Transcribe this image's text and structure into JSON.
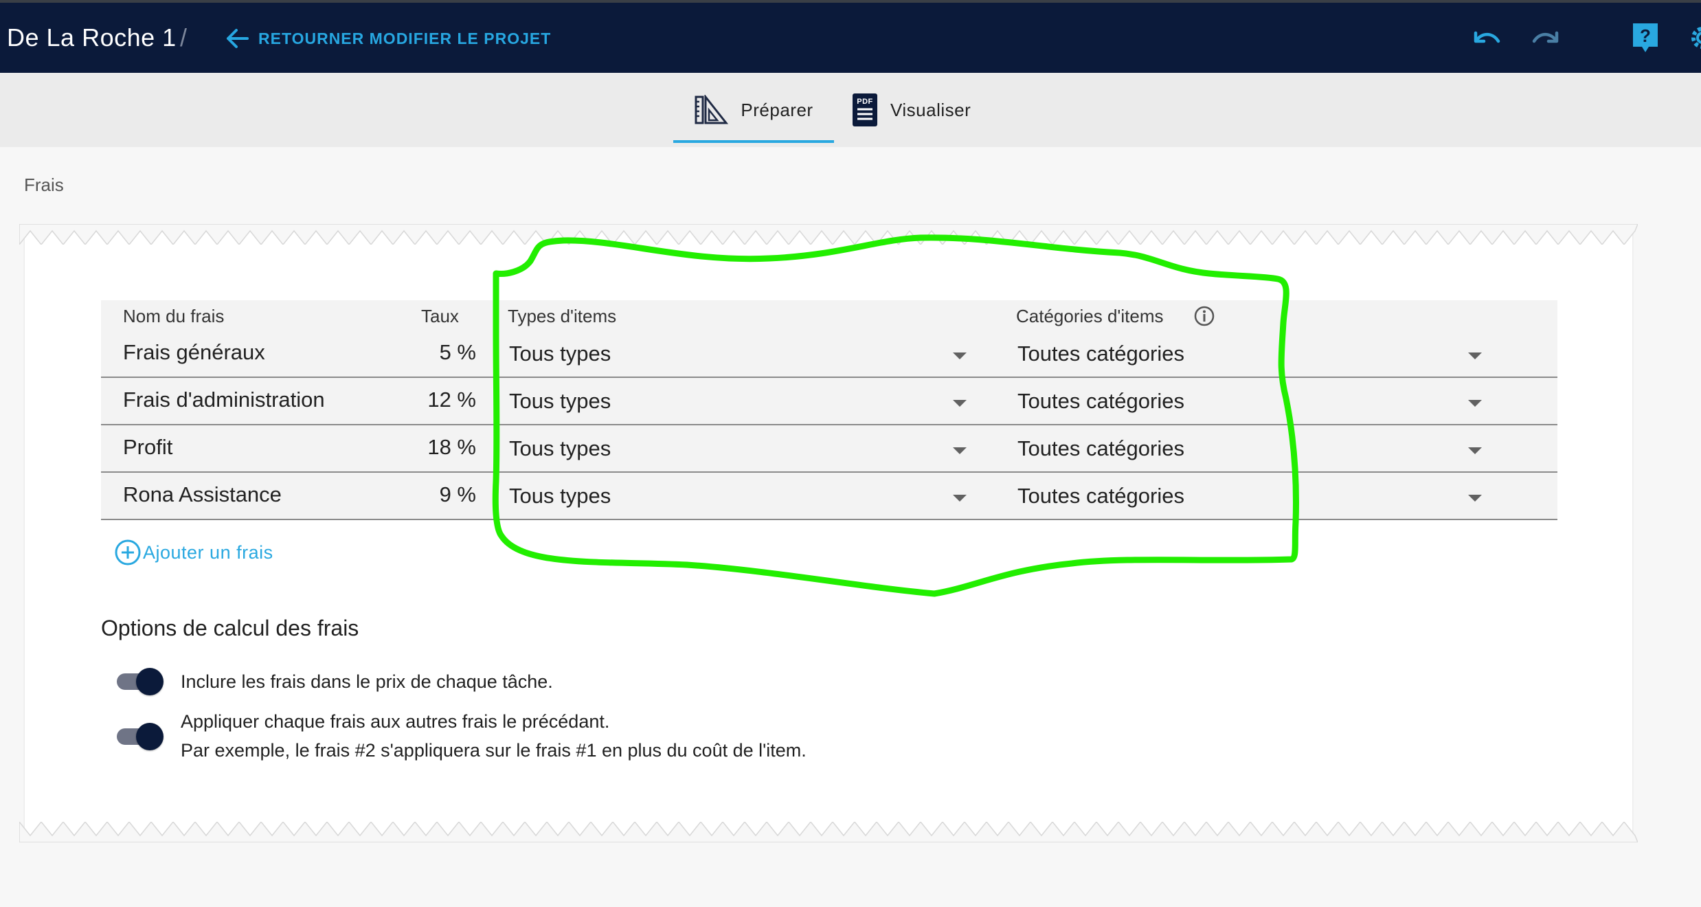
{
  "header": {
    "project_title": "De La Roche 1",
    "separator": "/",
    "back_link": "RETOURNER MODIFIER LE PROJET"
  },
  "tabs": {
    "prepare": "Préparer",
    "visualize": "Visualiser",
    "visualize_icon_text": "PDF"
  },
  "section_label": "Frais",
  "table": {
    "headers": {
      "name": "Nom du frais",
      "rate": "Taux",
      "types": "Types d'items",
      "categories": "Catégories d'items"
    },
    "rows": [
      {
        "name": "Frais généraux",
        "rate": "5 %",
        "type": "Tous types",
        "category": "Toutes catégories"
      },
      {
        "name": "Frais d'administration",
        "rate": "12 %",
        "type": "Tous types",
        "category": "Toutes catégories"
      },
      {
        "name": "Profit",
        "rate": "18 %",
        "type": "Tous types",
        "category": "Toutes catégories"
      },
      {
        "name": "Rona Assistance",
        "rate": "9 %",
        "type": "Tous types",
        "category": "Toutes catégories"
      }
    ]
  },
  "add_fee_label": "Ajouter un frais",
  "options": {
    "title": "Options de calcul des frais",
    "include_in_price": {
      "label": "Inclure les frais dans le prix de chaque tâche.",
      "enabled": true
    },
    "compound": {
      "label": "Appliquer chaque frais aux autres frais le précédant.",
      "hint": "Par exemple, le frais #2 s'appliquera sur le frais #1 en plus du coût de l'item.",
      "enabled": true
    }
  },
  "colors": {
    "header_bg": "#0b1a3a",
    "accent": "#29a8e0",
    "annotation": "#22ee00"
  }
}
